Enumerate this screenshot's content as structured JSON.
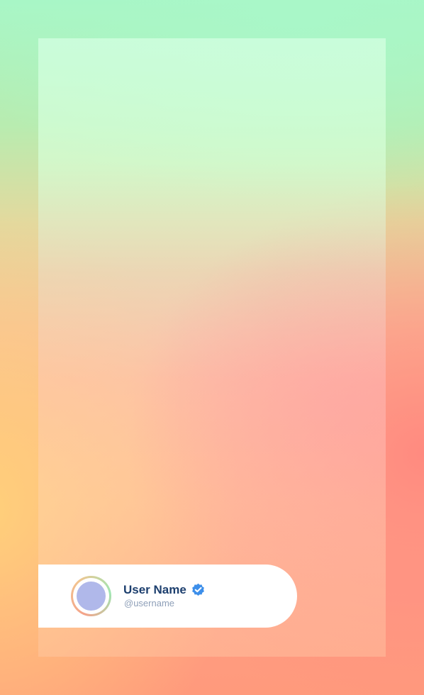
{
  "profile": {
    "name": "User Name",
    "handle": "@username",
    "verified_icon": "verified-badge-icon",
    "avatar_color": "#b0b8ea",
    "badge_color": "#3d8fea",
    "name_color": "#1d3f6e"
  }
}
